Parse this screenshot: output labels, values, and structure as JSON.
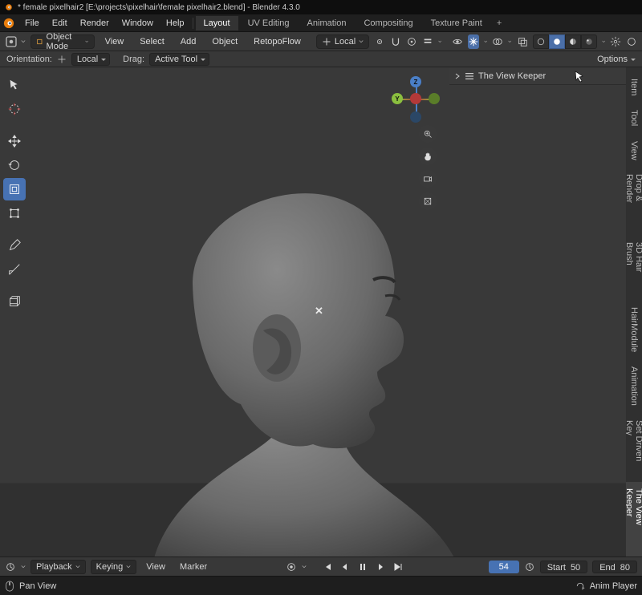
{
  "titlebar": {
    "text": "* female pixelhair2 [E:\\projects\\pixelhair\\female pixelhair2.blend] - Blender 4.3.0"
  },
  "menus": {
    "file": "File",
    "edit": "Edit",
    "render": "Render",
    "window": "Window",
    "help": "Help"
  },
  "workspaces": {
    "items": [
      "Layout",
      "UV Editing",
      "Animation",
      "Compositing",
      "Texture Paint"
    ],
    "add": "+",
    "active": 0
  },
  "header": {
    "mode": "Object Mode",
    "view": "View",
    "select": "Select",
    "add": "Add",
    "object": "Object",
    "retopoflow": "RetopoFlow",
    "orient": "Local"
  },
  "subheader": {
    "orientation_lbl": "Orientation:",
    "orientation_val": "Local",
    "drag_lbl": "Drag:",
    "drag_val": "Active Tool",
    "options": "Options"
  },
  "npanel": {
    "title": "The View Keeper"
  },
  "vtabs": {
    "items": [
      "Item",
      "Tool",
      "View",
      "Drop & Render",
      "3D Hair Brush",
      "HairModule",
      "Animation",
      "Set Driven Key",
      "The View Keeper"
    ],
    "active": 8
  },
  "viewport": {
    "cursor_glyph": "✕"
  },
  "timeline": {
    "playback": "Playback",
    "keying": "Keying",
    "view": "View",
    "marker": "Marker",
    "current_frame": "54",
    "start_lbl": "Start",
    "start_val": "50",
    "end_lbl": "End",
    "end_val": "80",
    "anim_player": "Anim Player"
  },
  "status": {
    "action": "Pan View"
  },
  "colors": {
    "accent": "#4772b3",
    "axis_x": "#b33939",
    "axis_y": "#8bbf3f",
    "axis_z": "#4a7fc8"
  }
}
